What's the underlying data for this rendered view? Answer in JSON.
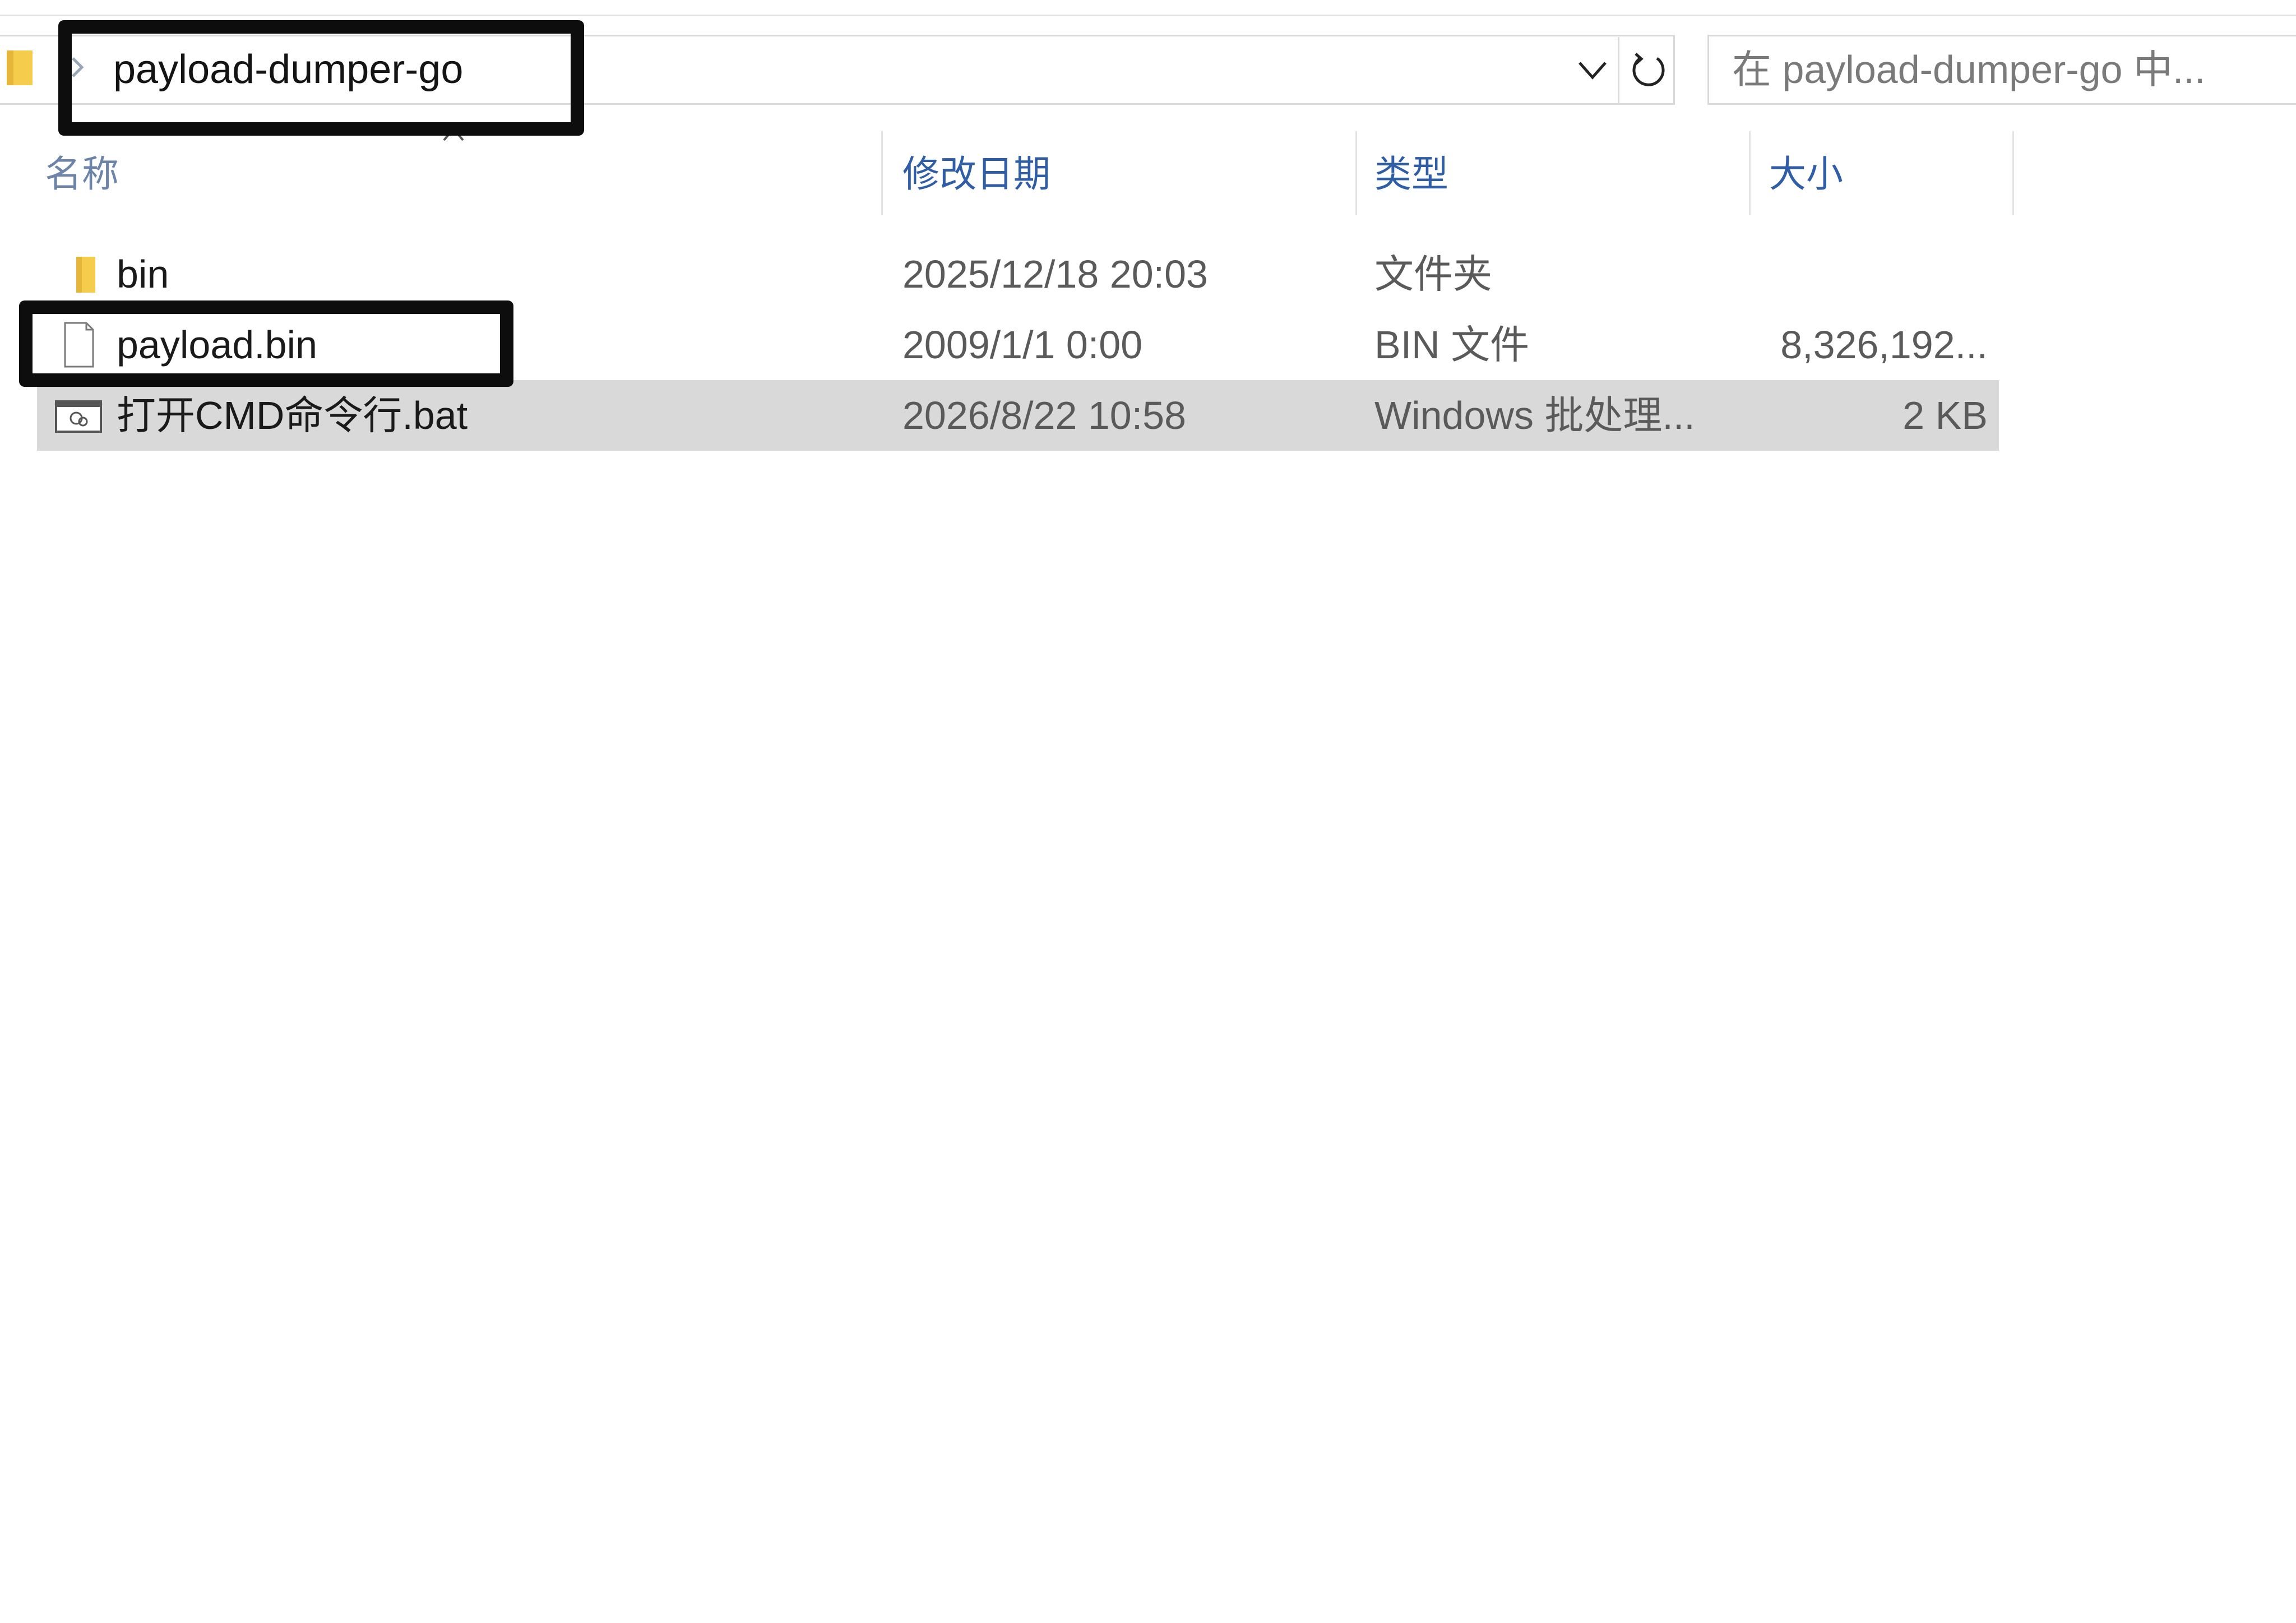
{
  "colors": {
    "header_text": "#2f5da6",
    "selected_row": "#d9d9d9",
    "annotation": "#0d0d0d",
    "folder": "#f5cc4c"
  },
  "address_bar": {
    "path": "payload-dumper-go",
    "folder_icon": "folder-icon",
    "separator_icon": "chevron-right-icon",
    "dropdown_icon": "chevron-down-icon",
    "refresh_icon": "refresh-icon"
  },
  "search": {
    "placeholder": "在 payload-dumper-go 中..."
  },
  "columns": {
    "name": "名称",
    "date": "修改日期",
    "type": "类型",
    "size": "大小"
  },
  "files": [
    {
      "name": "bin",
      "date": "2025/12/18 20:03",
      "type": "文件夹",
      "size": "",
      "icon": "folder-icon",
      "selected": false
    },
    {
      "name": "payload.bin",
      "date": "2009/1/1 0:00",
      "type": "BIN 文件",
      "size": "8,326,192...",
      "icon": "file-icon",
      "selected": false
    },
    {
      "name": "打开CMD命令行.bat",
      "date": "2026/8/22 10:58",
      "type": "Windows 批处理...",
      "size": "2 KB",
      "icon": "batch-file-icon",
      "selected": true
    }
  ]
}
